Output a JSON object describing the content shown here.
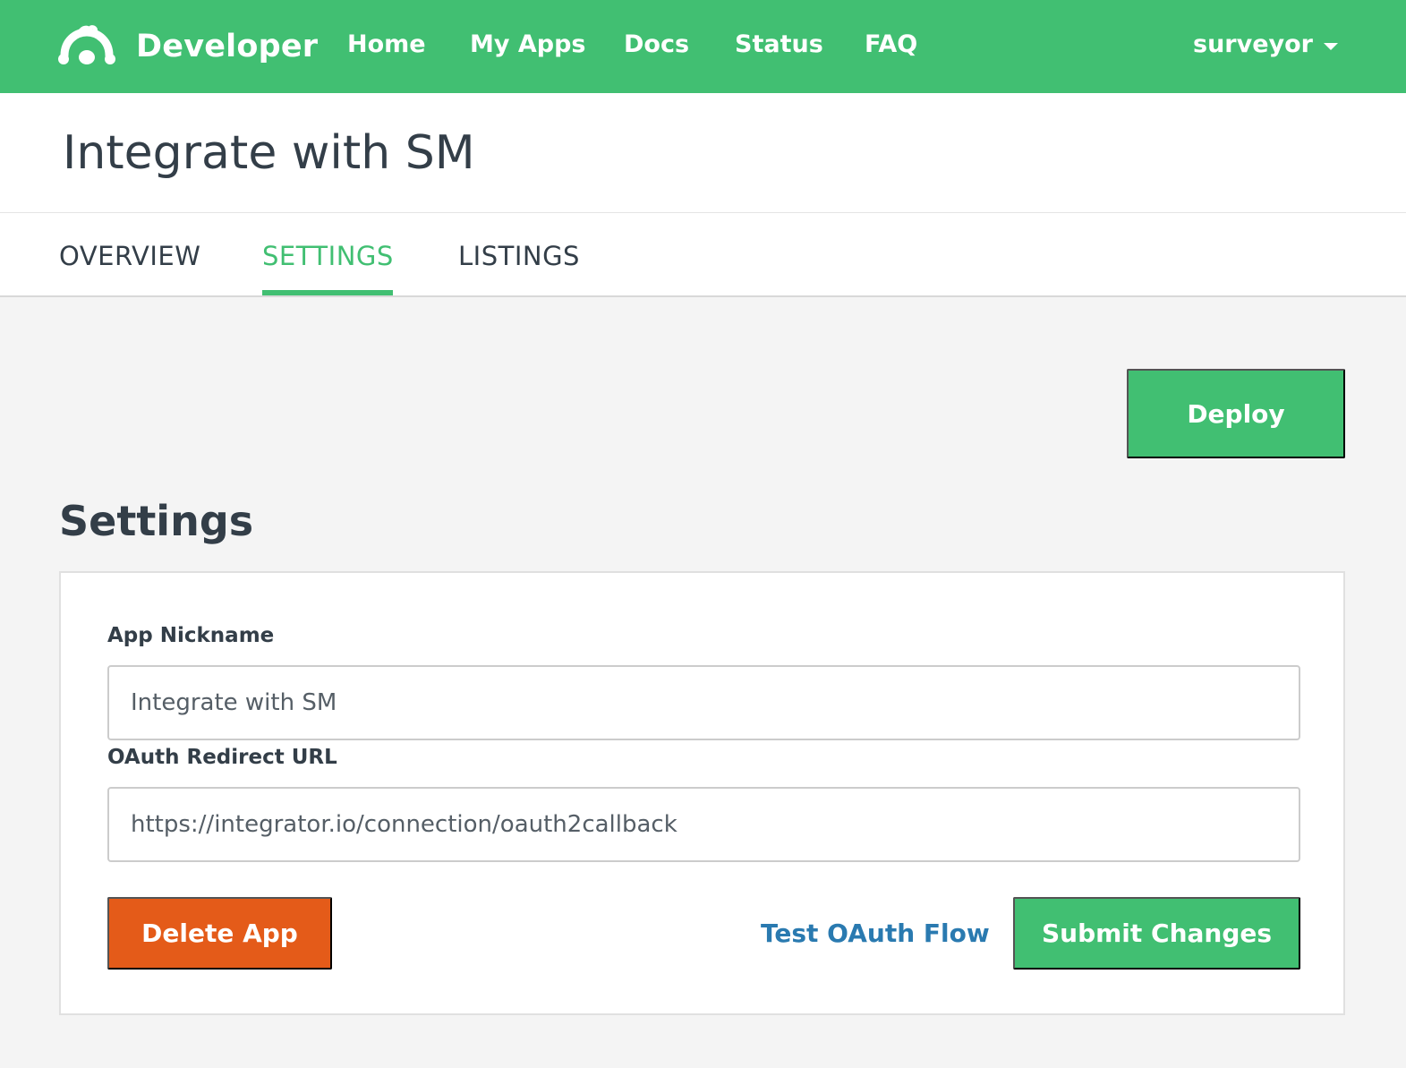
{
  "header": {
    "brand_name": "Developer",
    "logo_icon": "surveymonkey-logo-icon",
    "nav": [
      "Home",
      "My Apps",
      "Docs",
      "Status",
      "FAQ"
    ],
    "user": "surveyor",
    "user_menu_icon": "caret-down-icon"
  },
  "page": {
    "title": "Integrate with SM"
  },
  "tabs": {
    "items": [
      "OVERVIEW",
      "SETTINGS",
      "LISTINGS"
    ],
    "active": "SETTINGS"
  },
  "actions": {
    "deploy_label": "Deploy"
  },
  "settings": {
    "title": "Settings",
    "nickname_label": "App Nickname",
    "nickname_value": "Integrate with SM",
    "redirect_label": "OAuth Redirect URL",
    "redirect_value": "https://integrator.io/connection/oauth2callback",
    "delete_label": "Delete App",
    "test_label": "Test OAuth Flow",
    "submit_label": "Submit Changes"
  },
  "colors": {
    "brand_green": "#41bf72",
    "danger_orange": "#e45b19",
    "link_blue": "#2a7ab0",
    "text_dark": "#333e48",
    "page_bg": "#f4f4f4"
  }
}
